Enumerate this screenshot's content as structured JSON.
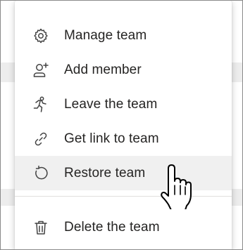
{
  "menu": {
    "items": [
      {
        "label": "Manage team",
        "icon": "gear-icon"
      },
      {
        "label": "Add member",
        "icon": "add-person-icon"
      },
      {
        "label": "Leave the team",
        "icon": "running-person-icon"
      },
      {
        "label": "Get link to team",
        "icon": "link-icon"
      },
      {
        "label": "Restore team",
        "icon": "restore-icon",
        "hovered": true
      },
      {
        "label": "Delete the team",
        "icon": "trash-icon"
      }
    ]
  },
  "colors": {
    "text": "#252423",
    "hover": "#f0f0f0",
    "divider": "#e1dfdd",
    "icon": "#424242"
  },
  "cursor": {
    "icon": "hand-pointer-icon"
  }
}
